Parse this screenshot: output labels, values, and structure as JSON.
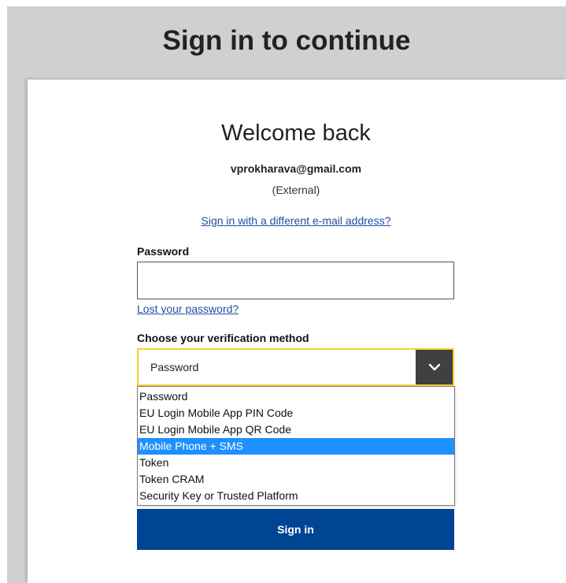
{
  "header": {
    "title": "Sign in to continue"
  },
  "card": {
    "welcome": "Welcome back",
    "email": "vprokharava@gmail.com",
    "account_type": "(External)",
    "different_email_link": "Sign in with a different e-mail address?"
  },
  "password": {
    "label": "Password",
    "value": "",
    "lost_link": "Lost your password?"
  },
  "verification": {
    "label": "Choose your verification method",
    "selected_value": "Password",
    "arrow_icon": "chevron-down-icon",
    "options": [
      {
        "label": "Password",
        "highlighted": false
      },
      {
        "label": "EU Login Mobile App PIN Code",
        "highlighted": false
      },
      {
        "label": "EU Login Mobile App QR Code",
        "highlighted": false
      },
      {
        "label": "Mobile Phone + SMS",
        "highlighted": true
      },
      {
        "label": "Token",
        "highlighted": false
      },
      {
        "label": "Token CRAM",
        "highlighted": false
      },
      {
        "label": "Security Key or Trusted Platform",
        "highlighted": false
      }
    ]
  },
  "actions": {
    "signin_label": "Sign in"
  },
  "colors": {
    "primary_button": "#004494",
    "focus_border": "#f5d22e",
    "link": "#1f4ea3",
    "highlight": "#1e90ff"
  }
}
